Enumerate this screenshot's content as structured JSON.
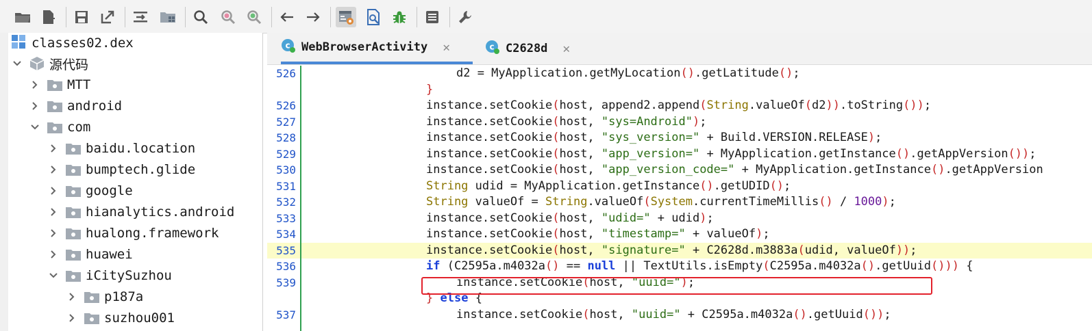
{
  "toolbar": {
    "buttons": [
      {
        "name": "open-folder-icon",
        "active": false
      },
      {
        "name": "add-file-icon",
        "active": false
      },
      {
        "name": "save-icon",
        "active": false
      },
      {
        "name": "export-icon",
        "active": false
      },
      {
        "name": "align-icon",
        "active": false
      },
      {
        "name": "folder-grid-icon",
        "active": false
      },
      {
        "name": "search-icon",
        "active": false
      },
      {
        "name": "search-class-icon",
        "active": false
      },
      {
        "name": "search-text-icon",
        "active": false
      },
      {
        "name": "back-arrow-icon",
        "active": false
      },
      {
        "name": "forward-arrow-icon",
        "active": false
      },
      {
        "name": "sync-tree-icon",
        "active": true
      },
      {
        "name": "deobfuscate-icon",
        "active": false
      },
      {
        "name": "debug-bug-icon",
        "active": false
      },
      {
        "name": "log-icon",
        "active": false
      },
      {
        "name": "settings-wrench-icon",
        "active": false
      }
    ]
  },
  "tree": {
    "root": "classes02.dex",
    "source": "源代码",
    "items": [
      {
        "label": "MTT",
        "depth": 1,
        "expanded": false
      },
      {
        "label": "android",
        "depth": 1,
        "expanded": false
      },
      {
        "label": "com",
        "depth": 1,
        "expanded": true
      },
      {
        "label": "baidu.location",
        "depth": 2,
        "expanded": false
      },
      {
        "label": "bumptech.glide",
        "depth": 2,
        "expanded": false
      },
      {
        "label": "google",
        "depth": 2,
        "expanded": false
      },
      {
        "label": "hianalytics.android",
        "depth": 2,
        "expanded": false
      },
      {
        "label": "hualong.framework",
        "depth": 2,
        "expanded": false
      },
      {
        "label": "huawei",
        "depth": 2,
        "expanded": false
      },
      {
        "label": "iCitySuzhou",
        "depth": 2,
        "expanded": true
      },
      {
        "label": "p187a",
        "depth": 3,
        "expanded": false
      },
      {
        "label": "suzhou001",
        "depth": 3,
        "expanded": false
      }
    ]
  },
  "tabs": [
    {
      "label": "WebBrowserActivity",
      "active": true
    },
    {
      "label": "C2628d",
      "active": false
    }
  ],
  "code": {
    "lines": [
      {
        "n": "526",
        "indent": 2,
        "tokens": [
          [
            "d2 = MyApplication.getMyLocation",
            "p"
          ],
          [
            "()",
            "br"
          ],
          [
            ".getLatitude",
            "p"
          ],
          [
            "()",
            "br"
          ],
          [
            ";",
            "p"
          ]
        ]
      },
      {
        "n": "",
        "indent": 1,
        "tokens": [
          [
            "}",
            "br"
          ]
        ]
      },
      {
        "n": "526",
        "indent": 1,
        "tokens": [
          [
            "instance.setCookie",
            "p"
          ],
          [
            "(",
            "br"
          ],
          [
            "host, append2.append",
            "p"
          ],
          [
            "(",
            "br"
          ],
          [
            "String",
            "ty"
          ],
          [
            ".valueOf",
            "p"
          ],
          [
            "(",
            "br"
          ],
          [
            "d2",
            "p"
          ],
          [
            "))",
            "br"
          ],
          [
            ".toString",
            "p"
          ],
          [
            "())",
            "br"
          ],
          [
            ";",
            "p"
          ]
        ]
      },
      {
        "n": "527",
        "indent": 1,
        "tokens": [
          [
            "instance.setCookie",
            "p"
          ],
          [
            "(",
            "br"
          ],
          [
            "host, ",
            "p"
          ],
          [
            "\"sys=Android\"",
            "st"
          ],
          [
            ")",
            "br"
          ],
          [
            ";",
            "p"
          ]
        ]
      },
      {
        "n": "528",
        "indent": 1,
        "tokens": [
          [
            "instance.setCookie",
            "p"
          ],
          [
            "(",
            "br"
          ],
          [
            "host, ",
            "p"
          ],
          [
            "\"sys_version=\"",
            "st"
          ],
          [
            " + Build.VERSION.RELEASE",
            "p"
          ],
          [
            ")",
            "br"
          ],
          [
            ";",
            "p"
          ]
        ]
      },
      {
        "n": "529",
        "indent": 1,
        "tokens": [
          [
            "instance.setCookie",
            "p"
          ],
          [
            "(",
            "br"
          ],
          [
            "host, ",
            "p"
          ],
          [
            "\"app_version=\"",
            "st"
          ],
          [
            " + MyApplication.getInstance",
            "p"
          ],
          [
            "()",
            "br"
          ],
          [
            ".getAppVersion",
            "p"
          ],
          [
            "())",
            "br"
          ],
          [
            ";",
            "p"
          ]
        ]
      },
      {
        "n": "530",
        "indent": 1,
        "tokens": [
          [
            "instance.setCookie",
            "p"
          ],
          [
            "(",
            "br"
          ],
          [
            "host, ",
            "p"
          ],
          [
            "\"app_version_code=\"",
            "st"
          ],
          [
            " + MyApplication.getInstance",
            "p"
          ],
          [
            "()",
            "br"
          ],
          [
            ".getAppVersion",
            "p"
          ]
        ]
      },
      {
        "n": "531",
        "indent": 1,
        "tokens": [
          [
            "String",
            "ty"
          ],
          [
            " udid = MyApplication.getInstance",
            "p"
          ],
          [
            "()",
            "br"
          ],
          [
            ".getUDID",
            "p"
          ],
          [
            "()",
            "br"
          ],
          [
            ";",
            "p"
          ]
        ]
      },
      {
        "n": "532",
        "indent": 1,
        "tokens": [
          [
            "String",
            "ty"
          ],
          [
            " valueOf = ",
            "p"
          ],
          [
            "String",
            "ty"
          ],
          [
            ".valueOf",
            "p"
          ],
          [
            "(",
            "br"
          ],
          [
            "System",
            "ty"
          ],
          [
            ".currentTimeMillis",
            "p"
          ],
          [
            "()",
            "br"
          ],
          [
            " / ",
            "p"
          ],
          [
            "1000",
            "cl"
          ],
          [
            ")",
            "br"
          ],
          [
            ";",
            "p"
          ]
        ]
      },
      {
        "n": "533",
        "indent": 1,
        "tokens": [
          [
            "instance.setCookie",
            "p"
          ],
          [
            "(",
            "br"
          ],
          [
            "host, ",
            "p"
          ],
          [
            "\"udid=\"",
            "st"
          ],
          [
            " + udid",
            "p"
          ],
          [
            ")",
            "br"
          ],
          [
            ";",
            "p"
          ]
        ]
      },
      {
        "n": "534",
        "indent": 1,
        "tokens": [
          [
            "instance.setCookie",
            "p"
          ],
          [
            "(",
            "br"
          ],
          [
            "host, ",
            "p"
          ],
          [
            "\"timestamp=\"",
            "st"
          ],
          [
            " + valueOf",
            "p"
          ],
          [
            ")",
            "br"
          ],
          [
            ";",
            "p"
          ]
        ]
      },
      {
        "n": "535",
        "indent": 1,
        "highlight": true,
        "tokens": [
          [
            "instance.setCookie",
            "p"
          ],
          [
            "(",
            "br"
          ],
          [
            "host, ",
            "p"
          ],
          [
            "\"signature=\"",
            "st"
          ],
          [
            " + C2628d.m3883a",
            "p"
          ],
          [
            "(",
            "br"
          ],
          [
            "udid, valueOf",
            "p"
          ],
          [
            "))",
            "br"
          ],
          [
            ";",
            "p"
          ]
        ]
      },
      {
        "n": "536",
        "indent": 1,
        "tokens": [
          [
            "if",
            "kw"
          ],
          [
            " (C2595a.m4032a",
            "p"
          ],
          [
            "()",
            "br"
          ],
          [
            " == ",
            "p"
          ],
          [
            "null",
            "kw"
          ],
          [
            " || TextUtils.isEmpty",
            "p"
          ],
          [
            "(",
            "br"
          ],
          [
            "C2595a.m4032a",
            "p"
          ],
          [
            "()",
            "br"
          ],
          [
            ".getUuid",
            "p"
          ],
          [
            "()))",
            "br"
          ],
          [
            " {",
            "p"
          ]
        ]
      },
      {
        "n": "539",
        "indent": 2,
        "tokens": [
          [
            "instance.setCookie",
            "p"
          ],
          [
            "(",
            "br"
          ],
          [
            "host, ",
            "p"
          ],
          [
            "\"uuid=\"",
            "st"
          ],
          [
            ")",
            "br"
          ],
          [
            ";",
            "p"
          ]
        ]
      },
      {
        "n": "",
        "indent": 1,
        "tokens": [
          [
            "}",
            "br"
          ],
          [
            " ",
            "p"
          ],
          [
            "else",
            "kw"
          ],
          [
            " {",
            "p"
          ]
        ]
      },
      {
        "n": "537",
        "indent": 2,
        "tokens": [
          [
            "instance.setCookie",
            "p"
          ],
          [
            "(",
            "br"
          ],
          [
            "host, ",
            "p"
          ],
          [
            "\"uuid=\"",
            "st"
          ],
          [
            " + C2595a.m4032a",
            "p"
          ],
          [
            "()",
            "br"
          ],
          [
            ".getUuid",
            "p"
          ],
          [
            "())",
            "br"
          ],
          [
            ";",
            "p"
          ]
        ]
      }
    ]
  }
}
